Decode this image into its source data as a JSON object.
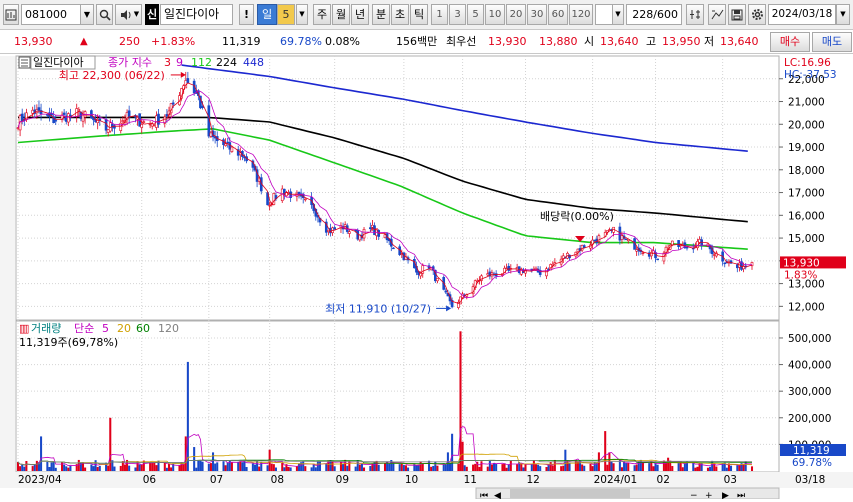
{
  "toolbar": {
    "code": "081000",
    "market_badge": "신",
    "stock_name": "일진다이아",
    "alert_icon": "!",
    "period_day": "일",
    "period_num": "5",
    "period_week": "주",
    "period_month": "월",
    "period_year": "년",
    "period_minute": "분",
    "period_second": "초",
    "period_tick": "틱",
    "intervals": [
      "1",
      "3",
      "5",
      "10",
      "20",
      "30",
      "60",
      "120"
    ],
    "count": "228/600",
    "date": "2024/03/18"
  },
  "quote": {
    "price": "13,930",
    "change_arrow": "▲",
    "change": "250",
    "change_pct": "+1.83%",
    "volume": "11,319",
    "volume_ratio": "69.78%",
    "turnover": "0.08%",
    "amount": "156백만",
    "best_label": "최우선",
    "best_ask": "13,930",
    "best_bid": "13,880",
    "open_label": "시",
    "open": "13,640",
    "high_label": "고",
    "high": "13,950",
    "low_label": "저",
    "low": "13,640",
    "buy_label": "매수",
    "sell_label": "매도"
  },
  "colors": {
    "up": "#e0001a",
    "down": "#1848c8",
    "ma3": "#e0001a",
    "ma9": "#c000c0",
    "ma112": "#18c818",
    "ma224": "#000000",
    "ma448": "#1c28d0",
    "vol5": "#c000c0",
    "vol20": "#d0a000",
    "vol60": "#008000",
    "vol120": "#808080"
  },
  "chart_data": [
    {
      "type": "candlestick",
      "title": "일진다이아",
      "legend": {
        "label": "종가 지수",
        "ma_periods": [
          "3",
          "9",
          "112",
          "224",
          "448"
        ]
      },
      "x_ticks": [
        "2023/04",
        "06",
        "07",
        "08",
        "09",
        "10",
        "11",
        "12",
        "2024/01",
        "02",
        "03",
        "03/18"
      ],
      "y_ticks": [
        "22,000",
        "21,000",
        "20,000",
        "19,000",
        "18,000",
        "17,000",
        "16,000",
        "15,000",
        "14,000",
        "13,000",
        "12,000"
      ],
      "ylim": [
        11400,
        23000
      ],
      "lc_label": "LC:16.96",
      "hc_label": "HC:-37.53",
      "last_price_label": "13,930",
      "last_change_label": "1.83%",
      "last_price": 13930,
      "high_annotation": {
        "text": "최고 22,300 (06/22)",
        "value": 22300
      },
      "low_annotation": {
        "text": "최저 11,910 (10/27)",
        "value": 11910
      },
      "dividend_annotation": {
        "text": "배당락(0.00%)",
        "date": "2023-12-27"
      },
      "close_anchors": [
        [
          "2023-04-03",
          20100
        ],
        [
          "2023-04-10",
          20600
        ],
        [
          "2023-04-20",
          20200
        ],
        [
          "2023-05-02",
          20500
        ],
        [
          "2023-05-15",
          19800
        ],
        [
          "2023-05-25",
          20300
        ],
        [
          "2023-06-05",
          20000
        ],
        [
          "2023-06-14",
          20500
        ],
        [
          "2023-06-22",
          22000
        ],
        [
          "2023-06-28",
          21200
        ],
        [
          "2023-07-03",
          19500
        ],
        [
          "2023-07-10",
          19100
        ],
        [
          "2023-07-20",
          18600
        ],
        [
          "2023-07-27",
          17500
        ],
        [
          "2023-07-31",
          16500
        ],
        [
          "2023-08-07",
          17100
        ],
        [
          "2023-08-14",
          16800
        ],
        [
          "2023-08-22",
          16300
        ],
        [
          "2023-08-29",
          15300
        ],
        [
          "2023-09-05",
          15500
        ],
        [
          "2023-09-12",
          15100
        ],
        [
          "2023-09-19",
          15400
        ],
        [
          "2023-09-26",
          14900
        ],
        [
          "2023-10-04",
          14200
        ],
        [
          "2023-10-10",
          13500
        ],
        [
          "2023-10-16",
          13800
        ],
        [
          "2023-10-20",
          13100
        ],
        [
          "2023-10-27",
          12000
        ],
        [
          "2023-11-03",
          12600
        ],
        [
          "2023-11-10",
          13300
        ],
        [
          "2023-11-20",
          13500
        ],
        [
          "2023-11-30",
          13600
        ],
        [
          "2023-12-08",
          13500
        ],
        [
          "2023-12-15",
          13900
        ],
        [
          "2023-12-22",
          14300
        ],
        [
          "2023-12-28",
          14600
        ],
        [
          "2024-01-05",
          15000
        ],
        [
          "2024-01-12",
          15300
        ],
        [
          "2024-01-19",
          14800
        ],
        [
          "2024-01-26",
          14500
        ],
        [
          "2024-02-02",
          14200
        ],
        [
          "2024-02-08",
          14700
        ],
        [
          "2024-02-16",
          14600
        ],
        [
          "2024-02-23",
          14800
        ],
        [
          "2024-03-04",
          14100
        ],
        [
          "2024-03-11",
          13700
        ],
        [
          "2024-03-18",
          13930
        ]
      ],
      "ma_anchors": {
        "ma112": [
          [
            "2023-04-03",
            19200
          ],
          [
            "2023-05-15",
            19500
          ],
          [
            "2023-06-15",
            19700
          ],
          [
            "2023-07-05",
            19800
          ],
          [
            "2023-08-01",
            19300
          ],
          [
            "2023-09-01",
            18300
          ],
          [
            "2023-10-02",
            17300
          ],
          [
            "2023-11-01",
            16100
          ],
          [
            "2023-12-01",
            15100
          ],
          [
            "2024-01-02",
            14800
          ],
          [
            "2024-02-01",
            14800
          ],
          [
            "2024-03-18",
            14500
          ]
        ],
        "ma224": [
          [
            "2023-04-03",
            20300
          ],
          [
            "2023-06-01",
            20300
          ],
          [
            "2023-07-03",
            20300
          ],
          [
            "2023-08-01",
            20100
          ],
          [
            "2023-09-01",
            19400
          ],
          [
            "2023-10-04",
            18500
          ],
          [
            "2023-11-01",
            17500
          ],
          [
            "2023-12-01",
            16700
          ],
          [
            "2024-01-02",
            16300
          ],
          [
            "2024-02-01",
            16100
          ],
          [
            "2024-03-18",
            15700
          ]
        ],
        "ma448": [
          [
            "2023-06-20",
            22600
          ],
          [
            "2023-08-01",
            22100
          ],
          [
            "2023-09-01",
            21600
          ],
          [
            "2023-10-04",
            21100
          ],
          [
            "2023-11-01",
            20600
          ],
          [
            "2023-12-01",
            20100
          ],
          [
            "2024-01-02",
            19600
          ],
          [
            "2024-02-01",
            19200
          ],
          [
            "2024-03-18",
            18800
          ]
        ]
      }
    },
    {
      "type": "bar",
      "title": "거래량",
      "legend": {
        "label": "단순",
        "ma_periods": [
          "5",
          "20",
          "60",
          "120"
        ]
      },
      "current_label": "11,319주(69,78%)",
      "y_ticks": [
        "500,000",
        "400,000",
        "300,000",
        "200,000",
        "100,000"
      ],
      "ylim": [
        0,
        560000
      ],
      "last_value_label": "11,319",
      "last_ratio_label": "69.78%",
      "base_volume": 30000,
      "spikes": [
        [
          "2023-04-14",
          130000
        ],
        [
          "2023-05-17",
          200000
        ],
        [
          "2023-06-22",
          130000
        ],
        [
          "2023-06-23",
          410000
        ],
        [
          "2023-06-26",
          90000
        ],
        [
          "2023-07-05",
          70000
        ],
        [
          "2023-08-01",
          80000
        ],
        [
          "2023-10-25",
          70000
        ],
        [
          "2023-10-27",
          140000
        ],
        [
          "2023-10-31",
          525000
        ],
        [
          "2023-11-01",
          110000
        ],
        [
          "2023-12-20",
          80000
        ],
        [
          "2024-01-05",
          70000
        ],
        [
          "2024-01-08",
          150000
        ],
        [
          "2024-01-10",
          70000
        ],
        [
          "2024-02-07",
          50000
        ]
      ]
    }
  ]
}
